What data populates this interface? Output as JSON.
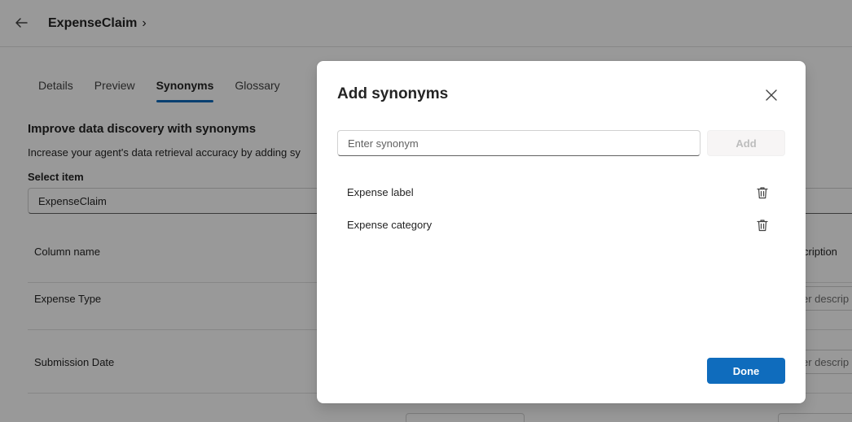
{
  "header": {
    "title": "ExpenseClaim",
    "chevron": "›"
  },
  "tabs": [
    {
      "label": "Details"
    },
    {
      "label": "Preview"
    },
    {
      "label": "Synonyms",
      "active": true
    },
    {
      "label": "Glossary"
    }
  ],
  "section": {
    "title": "Improve data discovery with synonyms",
    "description": "Increase your agent's data retrieval accuracy by adding sy"
  },
  "select_item": {
    "label": "Select item",
    "value": "ExpenseClaim"
  },
  "table": {
    "header": {
      "column_name": "Column name",
      "description": "cription"
    },
    "rows": [
      {
        "name": "Expense Type",
        "description_placeholder": "er descrip"
      },
      {
        "name": "Submission Date",
        "description_placeholder": "er descrip"
      }
    ]
  },
  "dialog": {
    "title": "Add synonyms",
    "input_placeholder": "Enter synonym",
    "add_label": "Add",
    "synonyms": [
      {
        "label": "Expense label"
      },
      {
        "label": "Expense category"
      }
    ],
    "done_label": "Done"
  },
  "icons": {
    "back": "arrow-left-icon",
    "close": "close-icon",
    "delete": "trash-icon"
  },
  "colors": {
    "accent": "#0f6cbd",
    "overlay": "rgba(0,0,0,0.40)"
  }
}
